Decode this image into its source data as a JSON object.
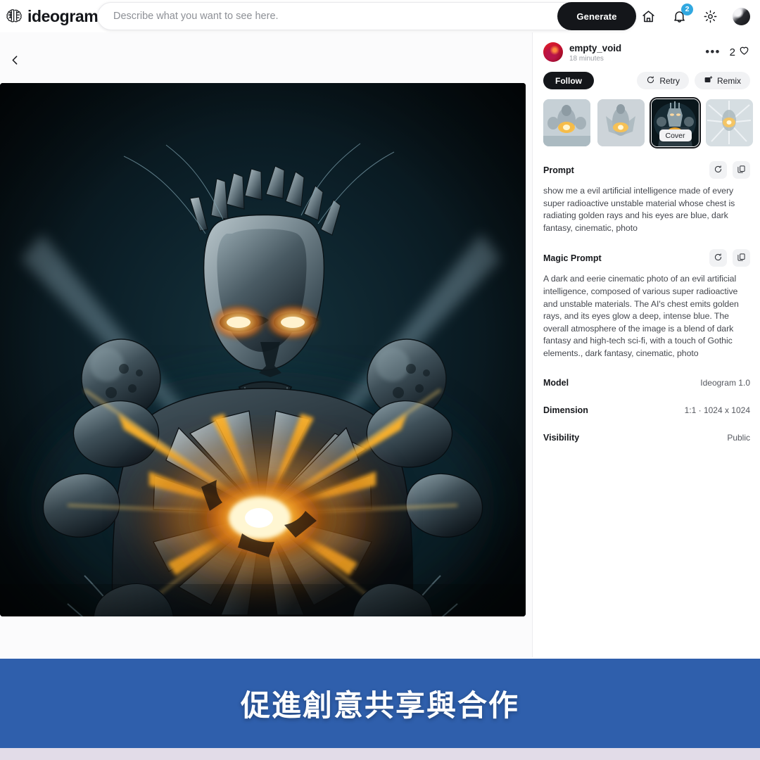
{
  "app": {
    "brand_name": "ideogram",
    "brand_icon": "brain-logo-icon"
  },
  "header": {
    "search_placeholder": "Describe what you want to see here.",
    "search_value": "",
    "generate_label": "Generate",
    "icons": {
      "home": "home-icon",
      "notifications": "bell-icon",
      "notification_count": "2",
      "settings": "gear-icon",
      "profile": "avatar-icon"
    },
    "badge_color": "#31a8e0"
  },
  "nav": {
    "back_label": "‹",
    "back_icon": "chevron-left-icon"
  },
  "detail": {
    "owner": {
      "username": "empty_void",
      "timestamp": "18 minutes",
      "avatar": "user-avatar"
    },
    "more_label": "•••",
    "likes_count": "2",
    "like_icon": "heart-icon",
    "follow_label": "Follow",
    "retry_label": "Retry",
    "retry_icon": "refresh-icon",
    "remix_label": "Remix",
    "remix_icon": "image-plus-icon",
    "thumbnails": [
      {
        "index": "1",
        "selected": false,
        "cover": false
      },
      {
        "index": "2",
        "selected": false,
        "cover": false
      },
      {
        "index": "3",
        "selected": true,
        "cover": true
      },
      {
        "index": "4",
        "selected": false,
        "cover": false
      }
    ],
    "cover_label": "Cover",
    "prompt": {
      "title": "Prompt",
      "text": "show me a evil artificial intelligence made of every super radioactive unstable material whose chest is radiating golden rays and his eyes are blue, dark fantasy, cinematic, photo",
      "regenerate_icon": "refresh-icon",
      "copy_icon": "copy-icon"
    },
    "magic_prompt": {
      "title": "Magic Prompt",
      "text": "A dark and eerie cinematic photo of an evil artificial intelligence, composed of various super radioactive and unstable materials. The AI's chest emits golden rays, and its eyes glow a deep, intense blue. The overall atmosphere of the image is a blend of dark fantasy and high-tech sci-fi, with a touch of Gothic elements., dark fantasy, cinematic, photo",
      "regenerate_icon": "refresh-icon",
      "copy_icon": "copy-icon"
    },
    "meta": [
      {
        "key": "Model",
        "value": "Ideogram 1.0"
      },
      {
        "key": "Dimension",
        "value": "1:1 · 1024 x 1024"
      },
      {
        "key": "Visibility",
        "value": "Public"
      }
    ]
  },
  "caption": {
    "text": "促進創意共享與合作",
    "bg_color": "#2f5fac",
    "text_color": "#ffffff"
  },
  "footer": {
    "strip_color": "#e2dce8"
  }
}
